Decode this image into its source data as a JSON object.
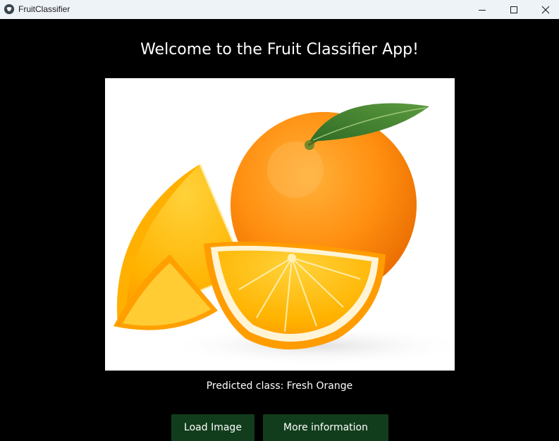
{
  "window": {
    "title": "FruitClassifier"
  },
  "main": {
    "heading": "Welcome to the Fruit Classifier App!",
    "image_icon": "orange-fruit-photo",
    "prediction_text": "Predicted class: Fresh Orange"
  },
  "buttons": {
    "load_image": "Load Image",
    "more_info": "More information"
  },
  "colors": {
    "background": "#000000",
    "titlebar": "#eef3f8",
    "button": "#123d1c",
    "text": "#ffffff"
  }
}
